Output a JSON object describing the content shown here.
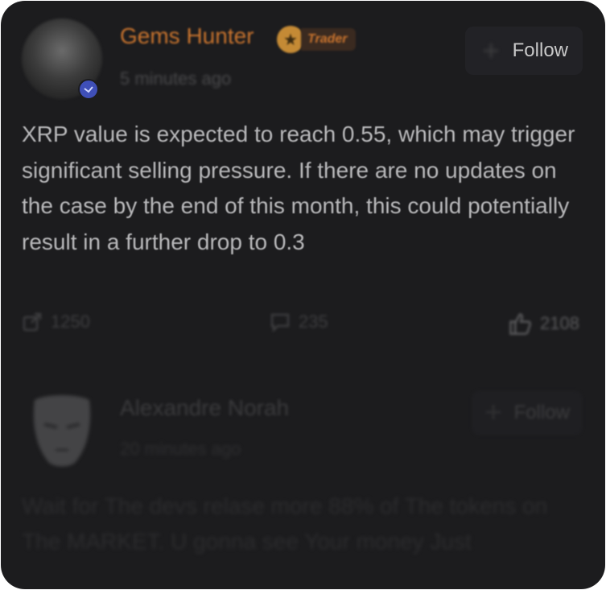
{
  "post": {
    "author": "Gems Hunter",
    "badge": "Trader",
    "time": "5 minutes ago",
    "follow_label": "Follow",
    "text": "XRP value is expected to reach 0.55, which may trigger significant selling pressure. If there are no updates on the case by the end of this month, this could potentially result in a further drop to 0.3",
    "share_count": "1250",
    "comment_count": "235",
    "like_count": "2108"
  },
  "comment": {
    "author": "Alexandre Norah",
    "time": "20 minutes ago",
    "follow_label": "Follow",
    "text": "Wait for The devs relase more 88% of The tokens on The MARKET. U gonna see Your money Just"
  },
  "colors": {
    "background": "#1c1c1e",
    "author_accent": "#c9742e",
    "verified": "#3f4fb8"
  },
  "icons": {
    "verified": "verified-check-icon",
    "badge": "star-icon",
    "share": "share-icon",
    "comment": "comment-icon",
    "like": "thumbs-up-icon"
  }
}
